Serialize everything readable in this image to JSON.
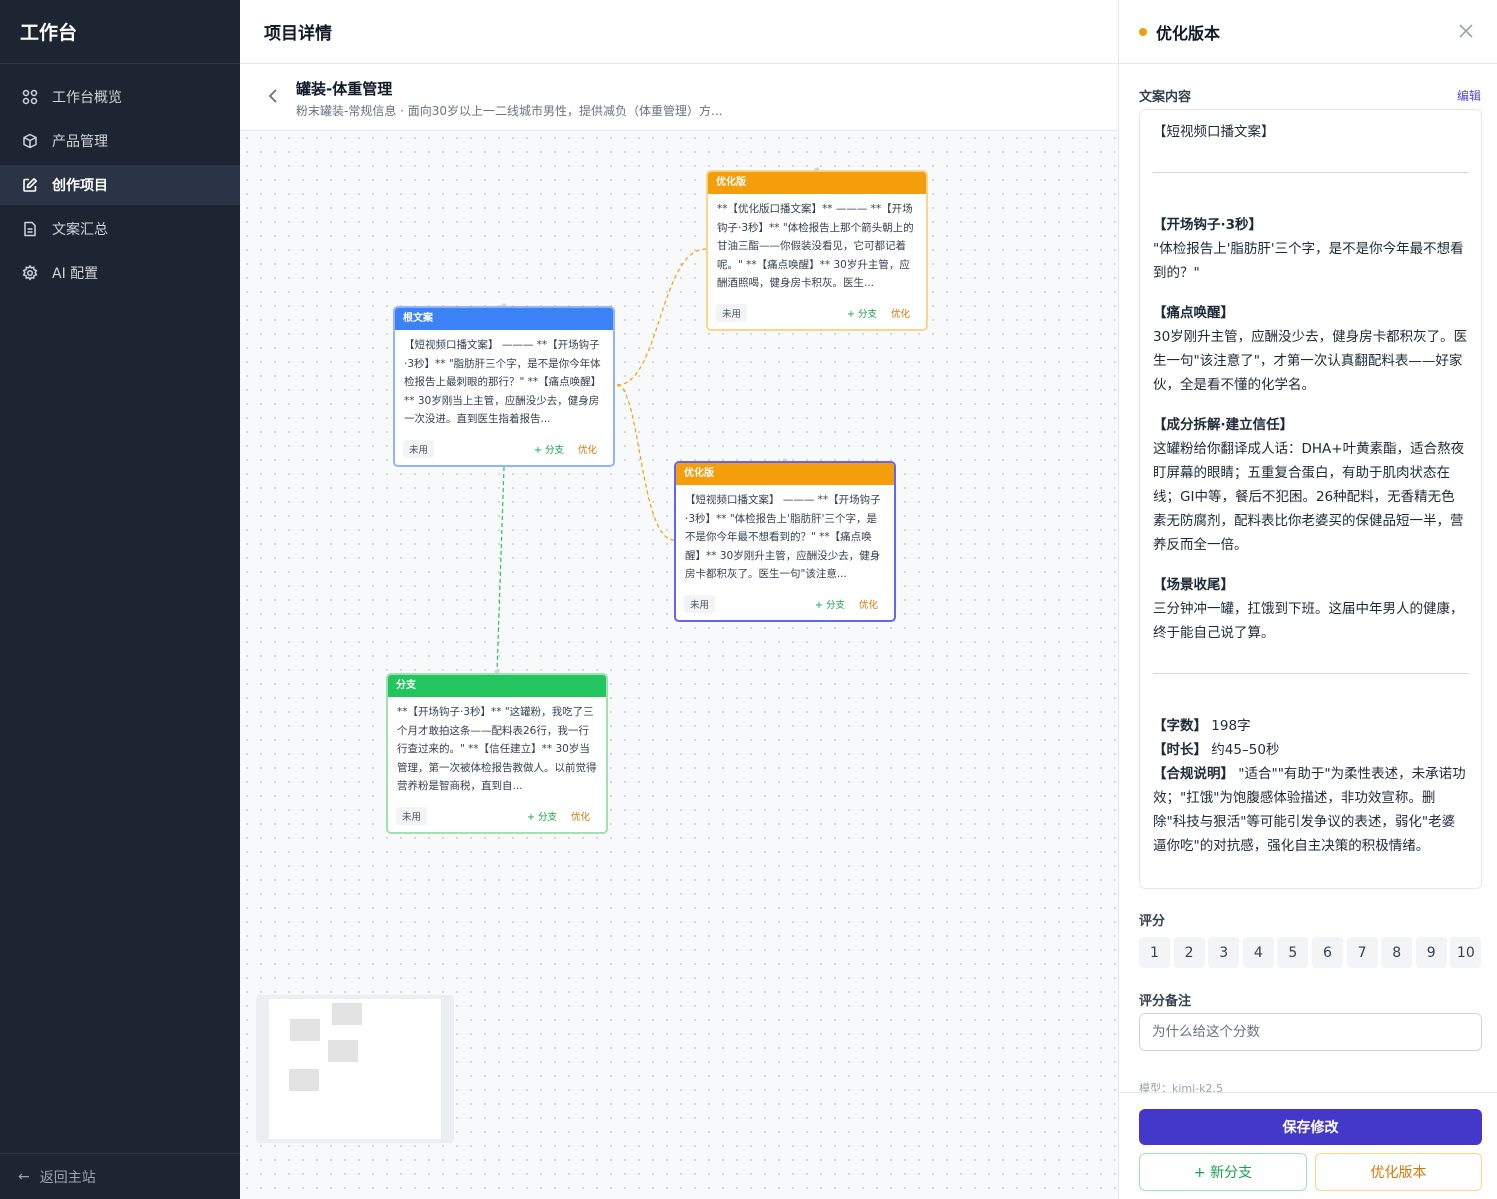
{
  "sidebar": {
    "brand": "工作台",
    "items": [
      {
        "label": "工作台概览",
        "icon": "grid-icon"
      },
      {
        "label": "产品管理",
        "icon": "box-icon"
      },
      {
        "label": "创作项目",
        "icon": "edit-icon",
        "active": true
      },
      {
        "label": "文案汇总",
        "icon": "document-icon"
      },
      {
        "label": "AI 配置",
        "icon": "gear-icon"
      }
    ],
    "back_label": "返回主站"
  },
  "header": {
    "title": "项目详情"
  },
  "project": {
    "title": "罐装-体重管理",
    "subtitle": "粉末罐装-常规信息 · 面向30岁以上一二线城市男性，提供减负（体重管理）方..."
  },
  "nodes": [
    {
      "header": "根文案",
      "body": "【短视频口播文案】 ——— **【开场钩子·3秒】** \"脂肪肝三个字，是不是你今年体检报告上最刺眼的那行？\" **【痛点唤醒】** 30岁刚当上主管，应酬没少去，健身房一次没进。直到医生指着报告...",
      "tag": "未用",
      "branch": "+ 分支",
      "optimize": "优化",
      "color": "#3b82f6"
    },
    {
      "header": "优化版",
      "body": "**【优化版口播文案】** ——— **【开场钩子·3秒】** \"体检报告上那个箭头朝上的甘油三酯——你假装没看见，它可都记着呢。\" **【痛点唤醒】** 30岁升主管，应酬酒照喝，健身房卡积灰。医生...",
      "tag": "未用",
      "branch": "+ 分支",
      "optimize": "优化",
      "color": "#f59e0b"
    },
    {
      "header": "优化版",
      "body": "【短视频口播文案】 ——— **【开场钩子·3秒】** \"体检报告上'脂肪肝'三个字，是不是你今年最不想看到的？\" **【痛点唤醒】** 30岁刚升主管，应酬没少去，健身房卡都积灰了。医生一句\"该注意...",
      "tag": "未用",
      "branch": "+ 分支",
      "optimize": "优化",
      "color": "#f59e0b"
    },
    {
      "header": "分支",
      "body": "**【开场钩子·3秒】** \"这罐粉，我吃了三个月才敢拍这条——配料表26行，我一行行查过来的。\" **【信任建立】** 30岁当管理，第一次被体检报告教做人。以前觉得营养粉是智商税，直到自...",
      "tag": "未用",
      "branch": "+ 分支",
      "optimize": "优化",
      "color": "#22c55e"
    }
  ],
  "panel": {
    "title": "优化版本",
    "content_label": "文案内容",
    "edit_label": "编辑",
    "content": {
      "title": "【短视频口播文案】",
      "sections": [
        {
          "heading": "【开场钩子·3秒】",
          "text": "\"体检报告上'脂肪肝'三个字，是不是你今年最不想看到的？\""
        },
        {
          "heading": "【痛点唤醒】",
          "text": "30岁刚升主管，应酬没少去，健身房卡都积灰了。医生一句\"该注意了\"，才第一次认真翻配料表——好家伙，全是看不懂的化学名。"
        },
        {
          "heading": "【成分拆解·建立信任】",
          "text": "这罐粉给你翻译成人话：DHA+叶黄素酯，适合熬夜盯屏幕的眼睛；五重复合蛋白，有助于肌肉状态在线；GI中等，餐后不犯困。26种配料，无香精无色素无防腐剂，配料表比你老婆买的保健品短一半，营养反而全一倍。"
        },
        {
          "heading": "【场景收尾】",
          "text": "三分钟冲一罐，扛饿到下班。这届中年男人的健康，终于能自己说了算。"
        }
      ],
      "word_count_label": "【字数】",
      "word_count": "198字",
      "duration_label": "【时长】",
      "duration": "约45–50秒",
      "compliance_label": "【合规说明】",
      "compliance": "\"适合\"\"有助于\"为柔性表述，未承诺功效；\"扛饿\"为饱腹感体验描述，非功效宣称。删除\"科技与狠活\"等可能引发争议的表述，弱化\"老婆逼你吃\"的对抗感，强化自主决策的积极情绪。"
    },
    "score_label": "评分",
    "scores": [
      "1",
      "2",
      "3",
      "4",
      "5",
      "6",
      "7",
      "8",
      "9",
      "10"
    ],
    "note_label": "评分备注",
    "note_placeholder": "为什么给这个分数",
    "model_text": "模型：kimi-k2.5",
    "save_label": "保存修改",
    "branch_label": "+ 新分支",
    "optimize_label": "优化版本"
  }
}
